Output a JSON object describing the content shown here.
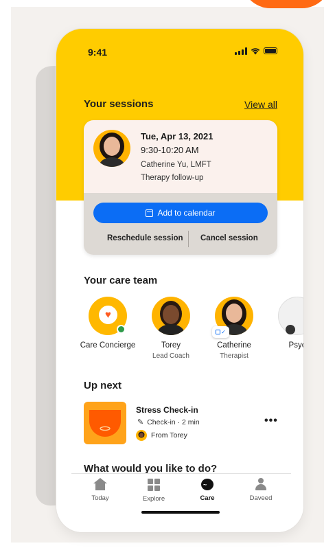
{
  "status_bar": {
    "time": "9:41"
  },
  "sessions": {
    "title": "Your sessions",
    "view_all": "View all",
    "card": {
      "date": "Tue, Apr 13, 2021",
      "time": "9:30-10:20 AM",
      "provider": "Catherine Yu, LMFT",
      "type": "Therapy follow-up",
      "add_calendar": "Add to calendar",
      "reschedule": "Reschedule session",
      "cancel": "Cancel session"
    }
  },
  "care_team": {
    "title": "Your care team",
    "members": [
      {
        "name": "Care Concierge",
        "role": ""
      },
      {
        "name": "Torey",
        "role": "Lead Coach"
      },
      {
        "name": "Catherine",
        "role": "Therapist"
      },
      {
        "name": "Psyc",
        "role": ""
      }
    ]
  },
  "up_next": {
    "title": "Up next",
    "task": {
      "name": "Stress Check-in",
      "meta": "Check-in · 2 min",
      "from": "From Torey"
    }
  },
  "todo": {
    "title": "What would you like to do?"
  },
  "nav": {
    "items": [
      {
        "label": "Today",
        "icon": "home-icon"
      },
      {
        "label": "Explore",
        "icon": "grid-icon"
      },
      {
        "label": "Care",
        "icon": "chat-bubble-icon"
      },
      {
        "label": "Daveed",
        "icon": "person-icon"
      }
    ],
    "active": "Care"
  },
  "colors": {
    "header_yellow": "#ffcc00",
    "primary_blue": "#0b6df5",
    "accent_orange": "#ff6a13",
    "online_green": "#2e9a4a"
  }
}
